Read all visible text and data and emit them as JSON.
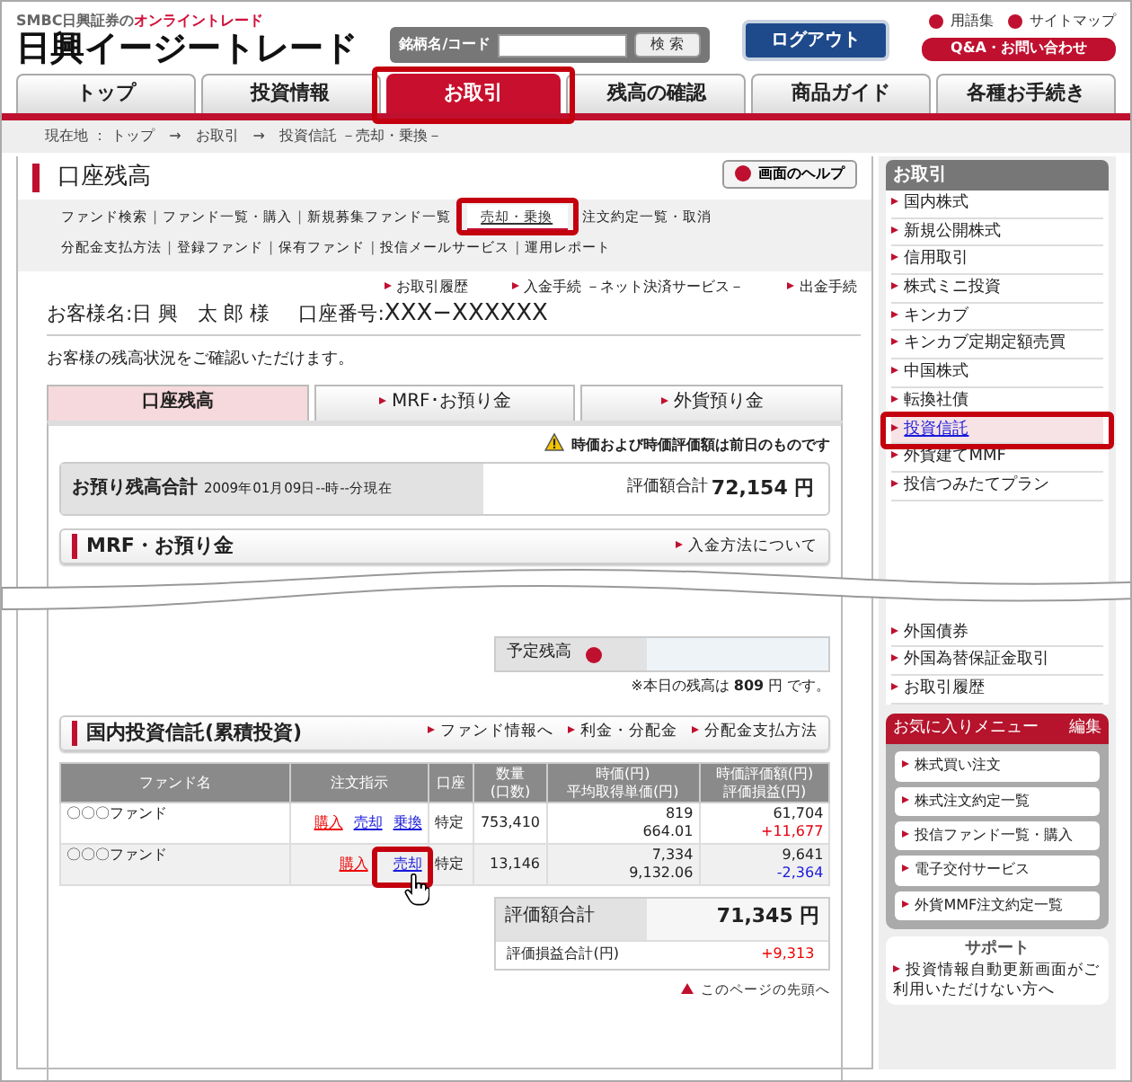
{
  "brand": {
    "tagline_prefix": "SMBC日興証券の",
    "tagline_highlight": "オンライントレード",
    "name": "日興イージートレード"
  },
  "search": {
    "label": "銘柄名/コード",
    "button": "検 索"
  },
  "logout": "ログアウト",
  "util_links": [
    "用語集",
    "サイトマップ"
  ],
  "qa_button": "Q&A・お問い合わせ",
  "tabs": [
    {
      "label": "トップ",
      "selected": false,
      "highlighted": false
    },
    {
      "label": "投資情報",
      "selected": false,
      "highlighted": false
    },
    {
      "label": "お取引",
      "selected": true,
      "highlighted": true
    },
    {
      "label": "残高の確認",
      "selected": false,
      "highlighted": false
    },
    {
      "label": "商品ガイド",
      "selected": false,
      "highlighted": false
    },
    {
      "label": "各種お手続き",
      "selected": false,
      "highlighted": false
    }
  ],
  "breadcrumb": {
    "label": "現在地 ：",
    "separator": "→",
    "links": [
      "トップ",
      "お取引"
    ],
    "current": "投資信託 －売却・乗換－"
  },
  "page_title": "口座残高",
  "help_button": "画面のヘルプ",
  "subnav_separator": "|",
  "subnav": [
    [
      {
        "label": "ファンド検索",
        "selected": false,
        "highlighted": false
      },
      {
        "label": "ファンド一覧・購入",
        "selected": false,
        "highlighted": false
      },
      {
        "label": "新規募集ファンド一覧",
        "selected": false,
        "highlighted": false
      },
      {
        "label": "売却・乗換",
        "selected": true,
        "highlighted": true
      },
      {
        "label": "注文約定一覧・取消",
        "selected": false,
        "highlighted": false
      }
    ],
    [
      {
        "label": "分配金支払方法",
        "selected": false,
        "highlighted": false
      },
      {
        "label": "登録ファンド",
        "selected": false,
        "highlighted": false
      },
      {
        "label": "保有ファンド",
        "selected": false,
        "highlighted": false
      },
      {
        "label": "投信メールサービス",
        "selected": false,
        "highlighted": false
      },
      {
        "label": "運用レポート",
        "selected": false,
        "highlighted": false
      }
    ]
  ],
  "action_links": [
    "お取引履歴",
    "入金手続 －ネット決済サービス－",
    "出金手続"
  ],
  "customer": {
    "name_label": "お客様名:",
    "name": "日 興　太 郎 様",
    "account_label": "口座番号:",
    "account": "XXX−XXXXXX"
  },
  "intro": "お客様の残高状況をご確認いただけます。",
  "balance_tabs": [
    {
      "label": "口座残高",
      "selected": true
    },
    {
      "label": "MRF･お預り金",
      "selected": false
    },
    {
      "label": "外貨預り金",
      "selected": false
    }
  ],
  "notice": "時価および時価評価額は前日のものです",
  "total": {
    "title": "お預り残高合計",
    "date": "2009年01月09日--時--分現在",
    "label": "評価額合計",
    "value": "72,154 円"
  },
  "mrf": {
    "title": "MRF・お預り金",
    "link": "入金方法について",
    "scheduled_label": "予定残高",
    "note": "※本日の残高は **809** 円 です。"
  },
  "funds": {
    "title": "国内投資信託(累積投資)",
    "links": [
      "ファンド情報へ",
      "利金・分配金",
      "分配金支払方法"
    ],
    "columns": [
      [
        "ファンド名"
      ],
      [
        "注文指示"
      ],
      [
        "口座"
      ],
      [
        "数量",
        "(口数)"
      ],
      [
        "時価(円)",
        "平均取得単価(円)"
      ],
      [
        "時価評価額(円)",
        "評価損益(円)"
      ]
    ],
    "rows": [
      {
        "name": "〇〇〇ファンド",
        "actions": [
          {
            "label": "購入",
            "kind": "buy",
            "highlighted": false
          },
          {
            "label": "売却",
            "kind": "sell",
            "highlighted": false
          },
          {
            "label": "乗換",
            "kind": "switch",
            "highlighted": false
          }
        ],
        "account": "特定",
        "quantity": "753,410",
        "price": "819",
        "avg_cost": "664.01",
        "value": "61,704",
        "pnl": {
          "text": "+11,677",
          "color": "#e60012"
        }
      },
      {
        "name": "〇〇〇ファンド",
        "actions": [
          {
            "label": "購入",
            "kind": "buy",
            "highlighted": false
          },
          {
            "label": "売却",
            "kind": "sell",
            "highlighted": true
          }
        ],
        "account": "特定",
        "quantity": "13,146",
        "price": "7,334",
        "avg_cost": "9,132.06",
        "value": "9,641",
        "pnl": {
          "text": "-2,364",
          "color": "#1a1adb"
        }
      }
    ]
  },
  "summary": {
    "value_label": "評価額合計",
    "value": "71,345 円",
    "pnl_label": "評価損益合計(円)",
    "pnl": "+9,313"
  },
  "page_top": "このページの先頭へ",
  "sidebar": {
    "title": "お取引",
    "items": [
      {
        "label": "国内株式",
        "highlighted": false
      },
      {
        "label": "新規公開株式",
        "highlighted": false
      },
      {
        "label": "信用取引",
        "highlighted": false
      },
      {
        "label": "株式ミニ投資",
        "highlighted": false
      },
      {
        "label": "キンカブ",
        "highlighted": false
      },
      {
        "label": "キンカブ定期定額売買",
        "highlighted": false
      },
      {
        "label": "中国株式",
        "highlighted": false
      },
      {
        "label": "転換社債",
        "highlighted": false
      },
      {
        "label": "投資信託",
        "highlighted": true
      },
      {
        "label": "外貨建てMMF",
        "highlighted": false
      },
      {
        "label": "投信つみたてプラン",
        "highlighted": false
      },
      {
        "label": "外国債券",
        "highlighted": false
      },
      {
        "label": "外国為替保証金取引",
        "highlighted": false
      },
      {
        "label": "お取引履歴",
        "highlighted": false
      }
    ]
  },
  "favorites": {
    "title": "お気に入りメニュー",
    "edit": "編集",
    "items": [
      "株式買い注文",
      "株式注文約定一覧",
      "投信ファンド一覧・購入",
      "電子交付サービス",
      "外貨MMF注文約定一覧"
    ]
  },
  "support": {
    "title": "サポート",
    "items": [
      "投資情報自動更新画面がご利用いただけない方へ"
    ]
  }
}
